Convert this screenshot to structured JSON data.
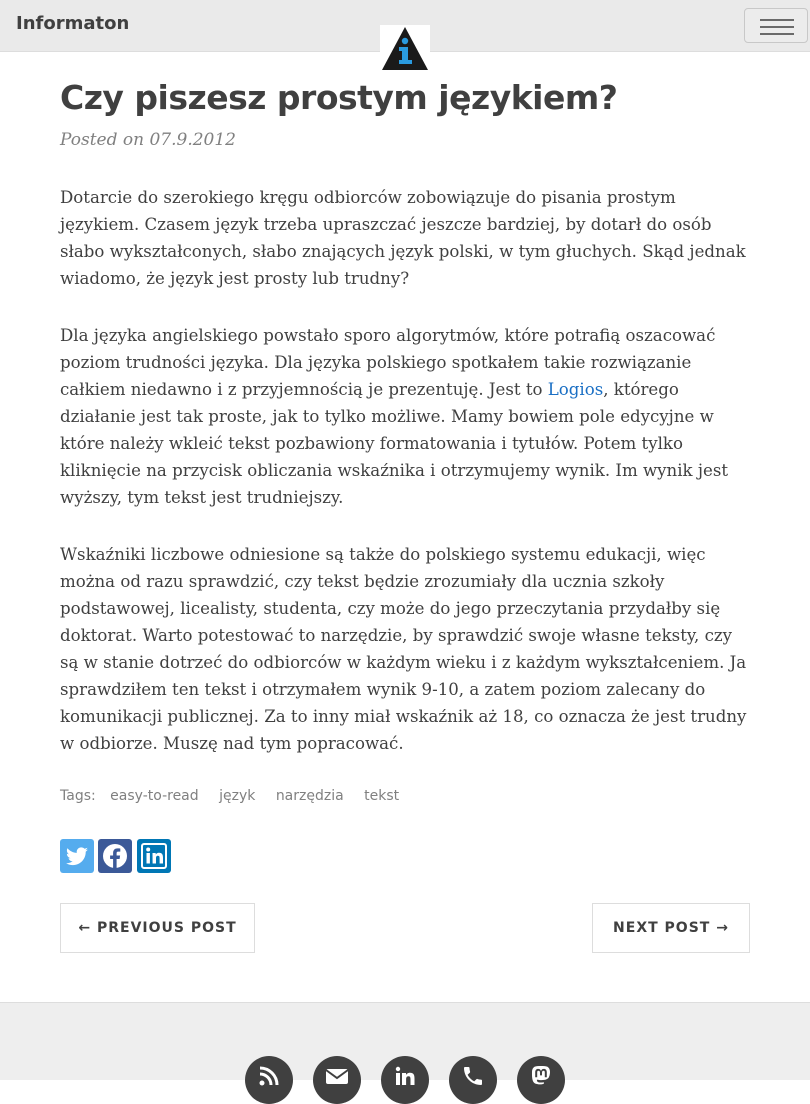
{
  "navbar": {
    "brand": "Informaton",
    "menu_toggle_icon": "hamburger-icon",
    "logo_icon": "info-triangle-logo"
  },
  "post": {
    "title": "Czy piszesz prostym językiem?",
    "meta": "Posted on 07.9.2012",
    "paragraphs": {
      "p1": "Dotarcie do szerokiego kręgu odbiorców zobowiązuje do pisania prostym językiem. Czasem język trzeba upraszczać jeszcze bardziej, by dotarł do osób słabo wykształconych, słabo znających język polski, w tym głuchych. Skąd jednak wiadomo, że język jest prosty lub trudny?",
      "p2_before": "Dla języka angielskiego powstało sporo algorytmów, które potrafią oszacować poziom trudności języka. Dla języka polskiego spotkałem takie rozwiązanie całkiem niedawno i z przyjemnością je prezentuję. Jest to ",
      "p2_link": "Logios",
      "p2_after": ", którego działanie jest tak proste, jak to tylko możliwe. Mamy bowiem pole edycyjne w które należy wkleić tekst pozbawiony formatowania i tytułów. Potem tylko kliknięcie na przycisk obliczania wskaźnika i otrzymujemy wynik. Im wynik jest wyższy, tym tekst jest trudniejszy.",
      "p3": "Wskaźniki liczbowe odniesione są także do polskiego systemu edukacji, więc można od razu sprawdzić, czy tekst będzie zrozumiały dla ucznia szkoły podstawowej, licealisty, studenta, czy może do jego przeczytania przydałby się doktorat. Warto potestować to narzędzie, by sprawdzić swoje własne teksty, czy są w stanie dotrzeć do odbiorców w każdym wieku i z każdym wykształceniem. Ja sprawdziłem ten tekst i otrzymałem wynik 9-10, a zatem poziom zalecany do komunikacji publicznej. Za to inny miał wskaźnik aż 18, co oznacza że jest trudny w odbiorze. Muszę nad tym popracować."
    },
    "tags_label": "Tags:",
    "tags": [
      "easy-to-read",
      "język",
      "narzędzia",
      "tekst"
    ]
  },
  "share": {
    "twitter_icon": "twitter-icon",
    "facebook_icon": "facebook-icon",
    "linkedin_icon": "linkedin-icon",
    "colors": {
      "twitter": "#55acee",
      "facebook": "#3b5998",
      "linkedin": "#0077b5"
    }
  },
  "pager": {
    "previous": "← PREVIOUS POST",
    "next": "NEXT POST →"
  },
  "footer": {
    "icons": [
      "rss-icon",
      "email-icon",
      "linkedin-icon",
      "phone-icon",
      "mastodon-icon"
    ]
  }
}
